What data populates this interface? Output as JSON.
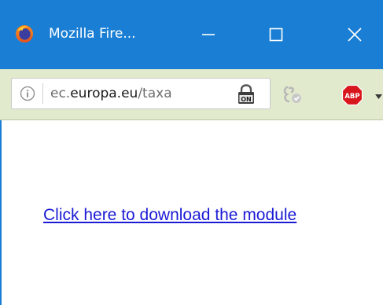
{
  "window": {
    "title": "Mozilla Fire...",
    "controls": {
      "minimize": "minimize",
      "maximize": "maximize",
      "close": "close"
    },
    "colors": {
      "titlebar": "#1a7fd4",
      "navbar": "#e1eacd",
      "link": "#1b1bd6"
    }
  },
  "urlbar": {
    "url_prefix": "ec.",
    "url_domain": "europa.eu",
    "url_suffix": "/taxa",
    "info_icon": "info-icon",
    "lock_icon": "lock-on-icon",
    "lock_badge": "ON"
  },
  "toolbar": {
    "extension_icon": "shield-extension-icon",
    "adblock_label": "ABP",
    "adblock_icon": "adblock-plus-icon"
  },
  "content": {
    "download_link": "Click here to download the module"
  }
}
